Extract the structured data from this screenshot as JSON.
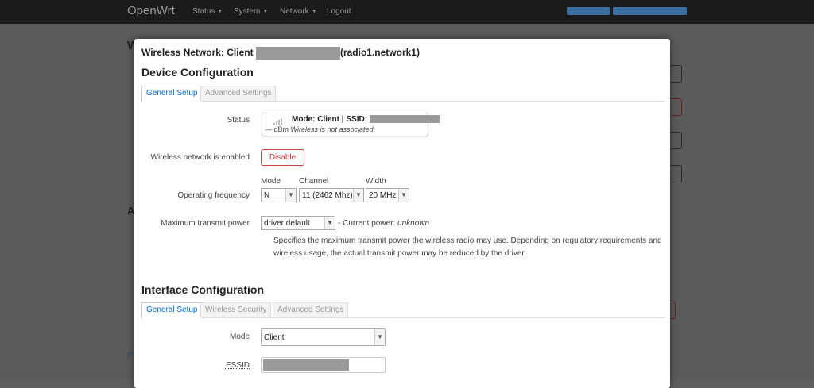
{
  "navbar": {
    "brand": "OpenWrt",
    "menu": [
      "Status",
      "System",
      "Network",
      "Logout"
    ]
  },
  "modal": {
    "title_prefix": "Wireless Network: Client",
    "title_suffix": "(radio1.network1)",
    "device_config": {
      "title": "Device Configuration",
      "tabs": [
        "General Setup",
        "Advanced Settings"
      ],
      "status_label": "Status",
      "status_mode": "Mode: Client | SSID:",
      "status_dbm": "— dBm",
      "status_msg": "Wireless is not associated",
      "enabled_label": "Wireless network is enabled",
      "disable_btn": "Disable",
      "freq_label": "Operating frequency",
      "mode_col": "Mode",
      "mode_value": "N",
      "channel_col": "Channel",
      "channel_value": "11 (2462 Mhz)",
      "width_col": "Width",
      "width_value": "20 MHz",
      "txpower_label": "Maximum transmit power",
      "txpower_value": "driver default",
      "current_power_prefix": "- Current power:",
      "current_power_value": "unknown",
      "txpower_help": "Specifies the maximum transmit power the wireless radio may use. Depending on regulatory requirements and wireless usage, the actual transmit power may be reduced by the driver."
    },
    "interface_config": {
      "title": "Interface Configuration",
      "tabs": [
        "General Setup",
        "Wireless Security",
        "Advanced Settings"
      ],
      "mode_label": "Mode",
      "mode_value": "Client",
      "essid_label": "ESSID"
    }
  },
  "background": {
    "heading_letters": [
      "W",
      "A"
    ],
    "link_letter": "P"
  },
  "colors": {
    "accent": "#0069d6",
    "danger": "#cc3333",
    "navbar": "#1b1b1b"
  }
}
